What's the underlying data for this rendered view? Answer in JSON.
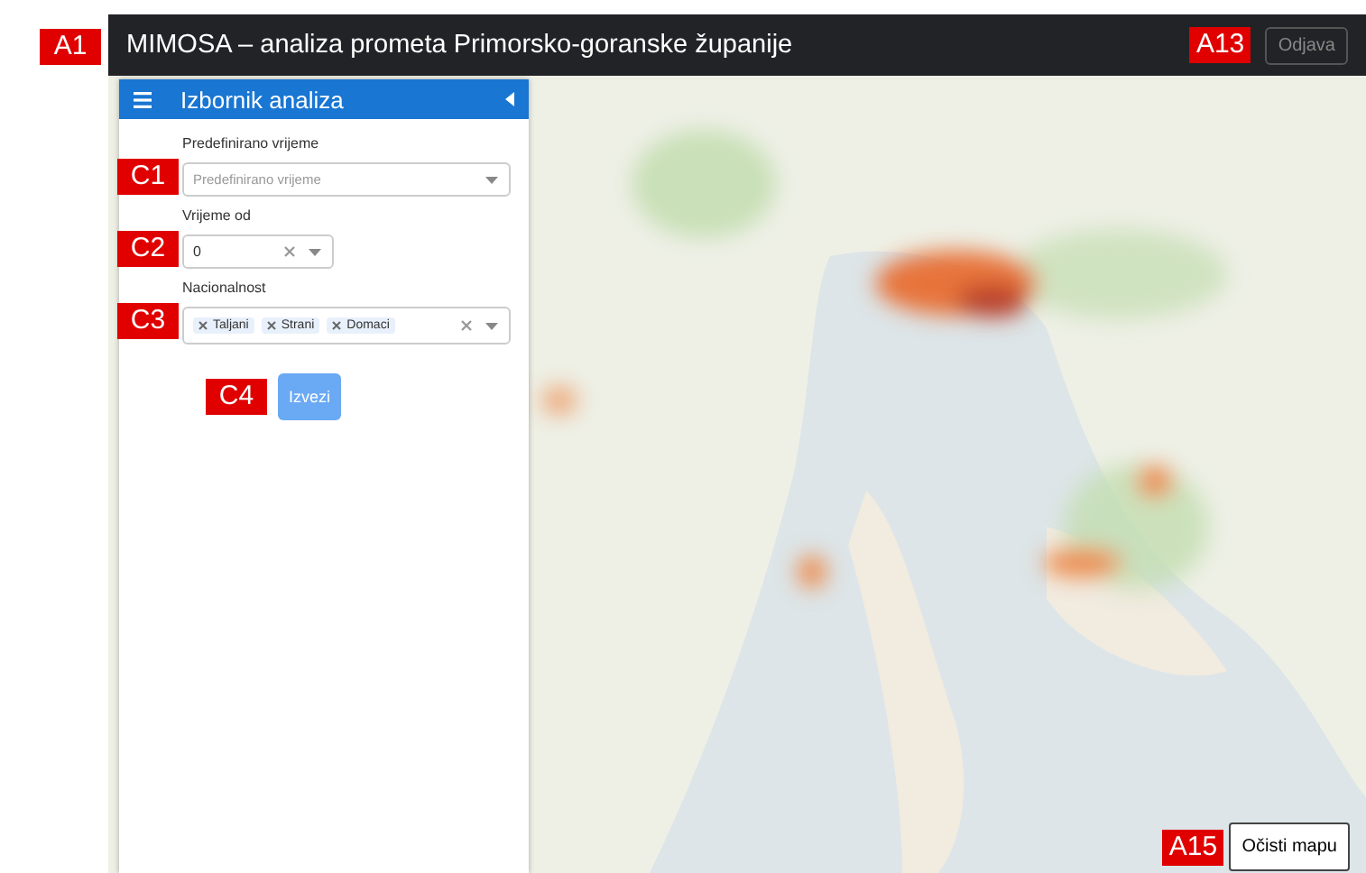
{
  "app_bar": {
    "callout": "A1",
    "title": "MIMOSA – analiza prometa Primorsko-goranske županije",
    "logout": {
      "label": "Odjava",
      "callout": "A13"
    }
  },
  "sidebar": {
    "title": "Izbornik analiza",
    "fields": [
      {
        "kind": "select",
        "label": "Predefinirano vrijeme",
        "placeholder": "Predefinirano vrijeme",
        "callout": "C1"
      },
      {
        "kind": "select-clear",
        "label": "Vrijeme od",
        "value": "0",
        "callout": "C2"
      },
      {
        "kind": "multi",
        "label": "Nacionalnost",
        "tags": [
          "Taljani",
          "Strani",
          "Domaci"
        ],
        "callout": "C3"
      }
    ],
    "export_button": {
      "label": "Izvezi",
      "disabled": true,
      "callout": "C4"
    }
  },
  "map": {
    "kind": "picture",
    "clear_button": {
      "label": "Očisti mapu",
      "callout": "A15"
    }
  }
}
